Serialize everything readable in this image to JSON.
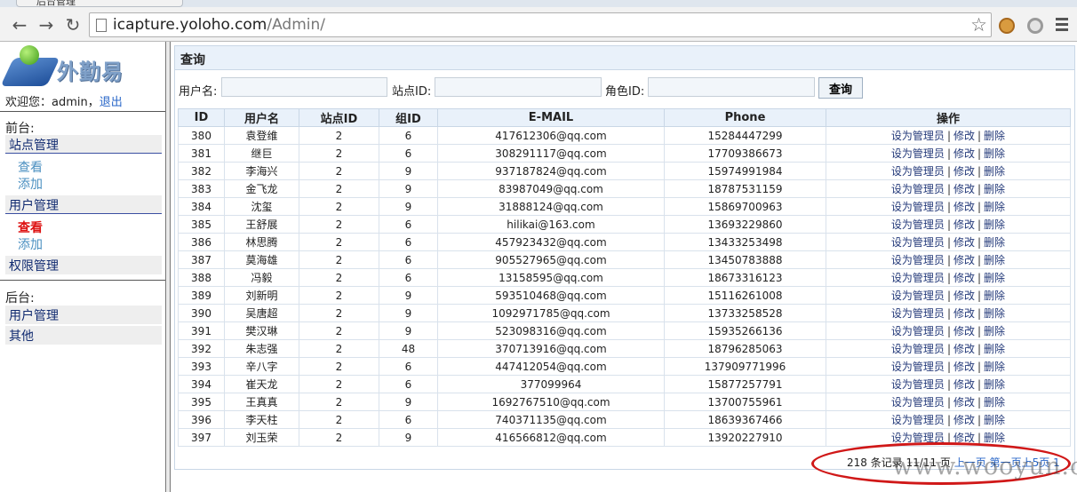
{
  "browser": {
    "tab_title": "后台管理",
    "url_host": "icapture.yoloho.com",
    "url_path": "/Admin/"
  },
  "sidebar": {
    "logo_text": "外勤易",
    "welcome_prefix": "欢迎您：admin，",
    "logout_label": "退出",
    "front_label": "前台:",
    "back_label": "后台:",
    "site_mgmt": "站点管理",
    "site_view": "查看",
    "site_add": "添加",
    "user_mgmt": "用户管理",
    "user_view": "查看",
    "user_add": "添加",
    "perm_mgmt": "权限管理",
    "back_user_mgmt": "用户管理",
    "back_other": "其他"
  },
  "panel": {
    "title": "查询"
  },
  "search": {
    "username_label": "用户名:",
    "username_value": "",
    "site_label": "站点ID:",
    "site_value": "",
    "role_label": "角色ID:",
    "role_value": "",
    "button_label": "查询"
  },
  "table": {
    "headers": [
      "ID",
      "用户名",
      "站点ID",
      "组ID",
      "E-MAIL",
      "Phone",
      "操作"
    ],
    "action_labels": [
      "设为管理员",
      "修改",
      "删除"
    ],
    "rows": [
      [
        "380",
        "袁登维",
        "2",
        "6",
        "417612306@qq.com",
        "15284447299"
      ],
      [
        "381",
        "继巨",
        "2",
        "6",
        "308291117@qq.com",
        "17709386673"
      ],
      [
        "382",
        "李海兴",
        "2",
        "9",
        "937187824@qq.com",
        "15974991984"
      ],
      [
        "383",
        "金飞龙",
        "2",
        "9",
        "83987049@qq.com",
        "18787531159"
      ],
      [
        "384",
        "沈玺",
        "2",
        "9",
        "31888124@qq.com",
        "15869700963"
      ],
      [
        "385",
        "王舒展",
        "2",
        "6",
        "hilikai@163.com",
        "13693229860"
      ],
      [
        "386",
        "林思腾",
        "2",
        "6",
        "457923432@qq.com",
        "13433253498"
      ],
      [
        "387",
        "莫海雄",
        "2",
        "6",
        "905527965@qq.com",
        "13450783888"
      ],
      [
        "388",
        "冯毅",
        "2",
        "6",
        "13158595@qq.com",
        "18673316123"
      ],
      [
        "389",
        "刘新明",
        "2",
        "9",
        "593510468@qq.com",
        "15116261008"
      ],
      [
        "390",
        "吴唐超",
        "2",
        "9",
        "1092971785@qq.com",
        "13733258528"
      ],
      [
        "391",
        "樊汉琳",
        "2",
        "9",
        "523098316@qq.com",
        "15935266136"
      ],
      [
        "392",
        "朱志强",
        "2",
        "48",
        "370713916@qq.com",
        "18796285063"
      ],
      [
        "393",
        "辛八字",
        "2",
        "6",
        "447412054@qq.com",
        "137909771996"
      ],
      [
        "394",
        "崔天龙",
        "2",
        "6",
        "377099964",
        "15877257791"
      ],
      [
        "395",
        "王真真",
        "2",
        "9",
        "1692767510@qq.com",
        "13700755961"
      ],
      [
        "396",
        "李天柱",
        "2",
        "6",
        "740371135@qq.com",
        "18639367466"
      ],
      [
        "397",
        "刘玉荣",
        "2",
        "9",
        "416566812@qq.com",
        "13920227910"
      ]
    ]
  },
  "pager": {
    "summary": "218 条记录 11/11 页",
    "prev": "上一页",
    "first": "第一页",
    "page5": "上5页",
    "last": "1"
  },
  "watermark": "www.wooyun.org",
  "colors": {
    "annotation_oval": "#d01818",
    "link": "#2a67c8",
    "active_menu": "#dd1111"
  }
}
